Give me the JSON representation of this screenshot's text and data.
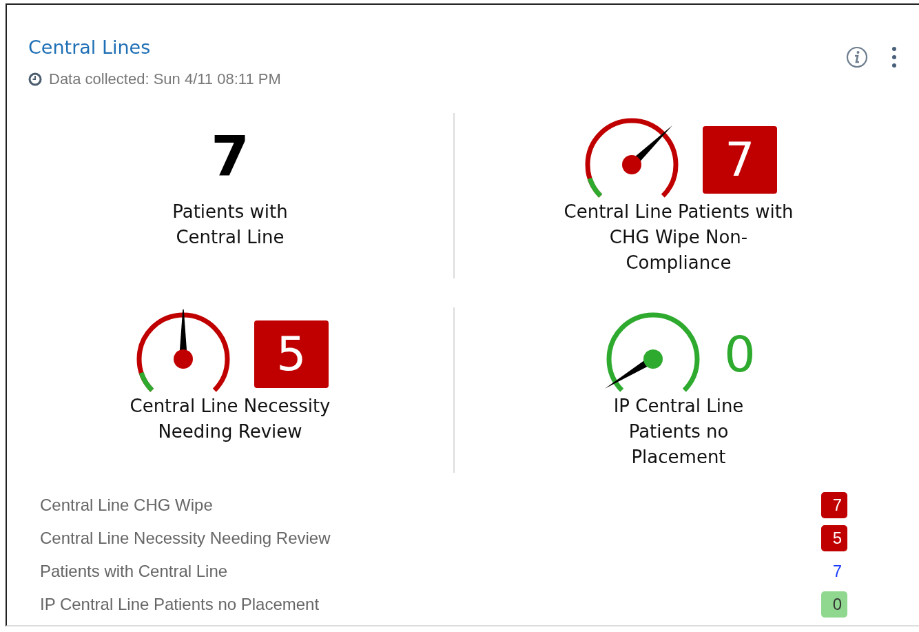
{
  "card": {
    "title": "Central Lines",
    "collected": "Data collected: Sun 4/11 08:11 PM"
  },
  "tiles": [
    {
      "kind": "plain",
      "value": "7",
      "label": "Patients with Central Line"
    },
    {
      "kind": "gauge-badge",
      "color": "#c00000",
      "value": "7",
      "label": "Central Line Patients with CHG Wipe Non-Compliance"
    },
    {
      "kind": "gauge-badge",
      "color": "#c00000",
      "value": "5",
      "label": "Central Line Necessity Needing Review"
    },
    {
      "kind": "gauge-text",
      "color": "#2eaa2e",
      "value": "0",
      "label": "IP Central Line Patients no Placement"
    }
  ],
  "legend": [
    {
      "label": "Central Line CHG Wipe",
      "value": "7",
      "kind": "badge",
      "color": "#c00000"
    },
    {
      "label": "Central Line Necessity Needing Review",
      "value": "5",
      "kind": "badge",
      "color": "#c00000"
    },
    {
      "label": "Patients with Central Line",
      "value": "7",
      "kind": "text",
      "color": "#1a3cff"
    },
    {
      "label": "IP Central Line Patients no Placement",
      "value": "0",
      "kind": "badge",
      "color": "#90d890"
    }
  ]
}
